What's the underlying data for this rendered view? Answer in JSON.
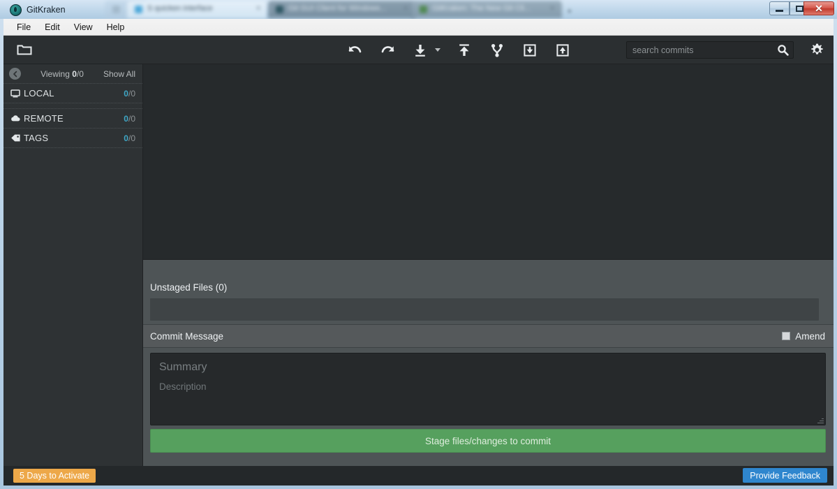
{
  "window": {
    "app_title": "GitKraken",
    "logo_icon": "kraken-logo",
    "minimize_label": "",
    "maximize_label": "",
    "close_label": "✕",
    "background_tabs": [
      {
        "title": "",
        "close": ""
      },
      {
        "title": "",
        "close": "×"
      },
      {
        "title": "",
        "close": "×"
      },
      {
        "title": "",
        "close": "×"
      }
    ],
    "new_tab_label": "+"
  },
  "menubar": {
    "items": [
      {
        "label": "File"
      },
      {
        "label": "Edit"
      },
      {
        "label": "View"
      },
      {
        "label": "Help"
      }
    ]
  },
  "toolbar": {
    "repo_icon": "folder-icon",
    "buttons": [
      {
        "name": "undo",
        "icon": "undo-icon"
      },
      {
        "name": "redo",
        "icon": "redo-icon"
      },
      {
        "name": "pull",
        "icon": "pull-down-arrow-icon"
      },
      {
        "name": "pull-dropdown",
        "icon": "chevron-down-icon"
      },
      {
        "name": "push",
        "icon": "push-up-arrow-icon"
      },
      {
        "name": "branch",
        "icon": "branch-icon"
      },
      {
        "name": "stash",
        "icon": "stash-down-icon"
      },
      {
        "name": "pop-stash",
        "icon": "stash-up-icon"
      }
    ],
    "search": {
      "placeholder": "search commits",
      "value": "",
      "icon": "search-icon"
    },
    "settings_icon": "gear-icon"
  },
  "sidebar": {
    "collapse_icon": "chevron-left-icon",
    "viewing_prefix": "Viewing ",
    "viewing_current": "0",
    "viewing_total": "/0",
    "show_all_label": "Show All",
    "sections": [
      {
        "label": "LOCAL",
        "icon": "monitor-icon",
        "count_current": "0",
        "count_total": "/0"
      },
      {
        "label": "REMOTE",
        "icon": "cloud-icon",
        "count_current": "0",
        "count_total": "/0"
      },
      {
        "label": "TAGS",
        "icon": "tag-icon",
        "count_current": "0",
        "count_total": "/0"
      }
    ]
  },
  "main": {
    "unstaged_title": "Unstaged Files (0)",
    "commit_message_label": "Commit Message",
    "amend_label": "Amend",
    "amend_checked": false,
    "summary_placeholder": "Summary",
    "description_placeholder": "Description",
    "summary_value": "",
    "description_value": "",
    "stage_button_label": "Stage files/changes to commit"
  },
  "status": {
    "activate_label": "5 Days to Activate",
    "feedback_label": "Provide Feedback"
  },
  "colors": {
    "accent_teal": "#3fa7c6",
    "stage_green": "#56a05e",
    "activate_orange": "#eda849",
    "feedback_blue": "#2f86ce",
    "panel_dark": "#262a2c",
    "panel_mid": "#4e5456",
    "chrome_dark": "#2e3234"
  }
}
